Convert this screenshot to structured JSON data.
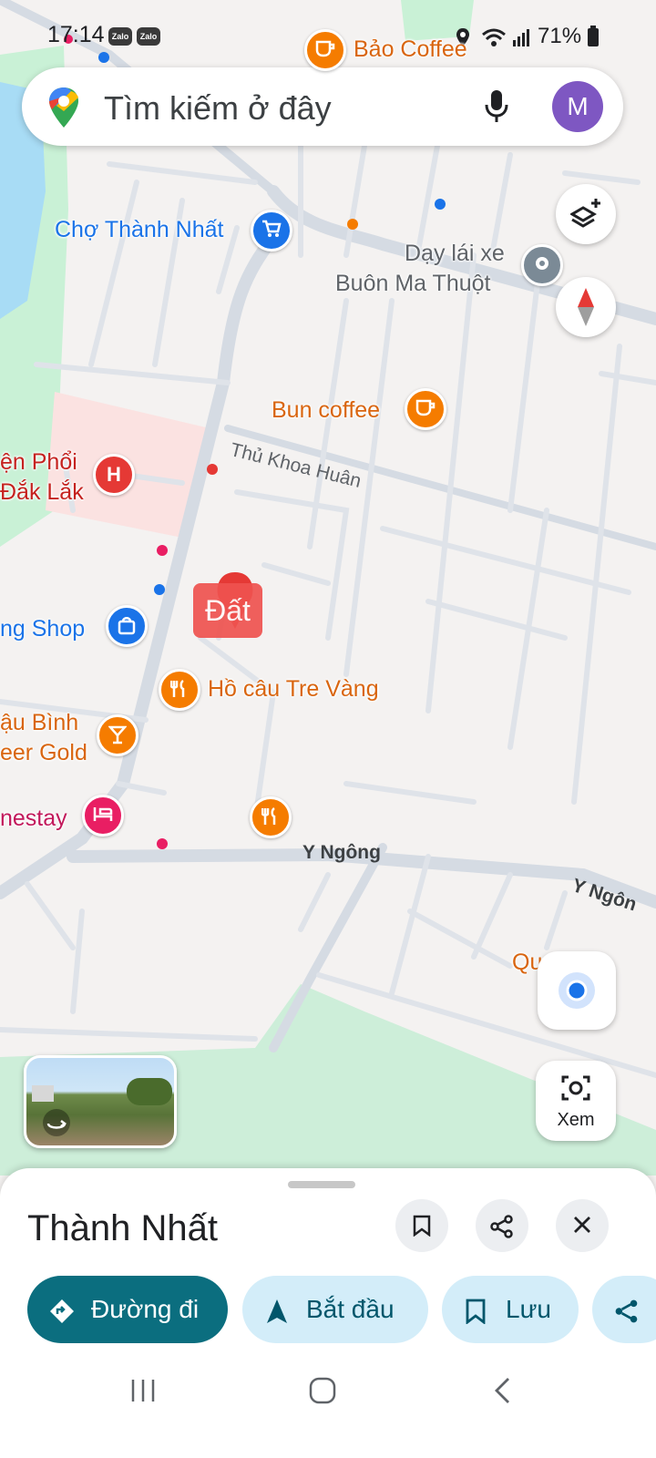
{
  "status_bar": {
    "time": "17:14",
    "notif1": "Zalo",
    "notif2": "Zalo",
    "battery": "71%"
  },
  "search": {
    "placeholder": "Tìm kiếm ở đây",
    "avatar_letter": "M"
  },
  "map_labels": {
    "bao_coffee": "Bảo Coffee",
    "cho_thanh_nhat": "Chợ Thành Nhất",
    "day_lai_xe_1": "Dạy lái xe",
    "day_lai_xe_2": "Buôn Ma Thuột",
    "bun_coffee": "Bun coffee",
    "hospital_1": "ện Phổi",
    "hospital_2": "Đắk Lắk",
    "shop": "ng Shop",
    "dat": "Đất",
    "ho_cau": "Hồ câu Tre Vàng",
    "beer_1": "ậu Bình",
    "beer_2": "eer Gold",
    "homestay": "nestay",
    "qu_right": "Qu     m C"
  },
  "streets": {
    "thu_khoa_huan": "Thủ Khoa Huân",
    "y_ngong": "Y Ngông",
    "y_ngong_2": "Y Ngôn"
  },
  "controls": {
    "lens_label": "Xem"
  },
  "place_sheet": {
    "title": "Thành Nhất",
    "chips": [
      {
        "label": "Đường đi"
      },
      {
        "label": "Bắt đầu"
      },
      {
        "label": "Lưu"
      }
    ]
  },
  "colors": {
    "accent": "#0b6e7f",
    "chip_bg": "#d3edf9",
    "map_bg": "#f4f2f1",
    "road": "#d5dbe3",
    "park": "#c9f1d6"
  }
}
